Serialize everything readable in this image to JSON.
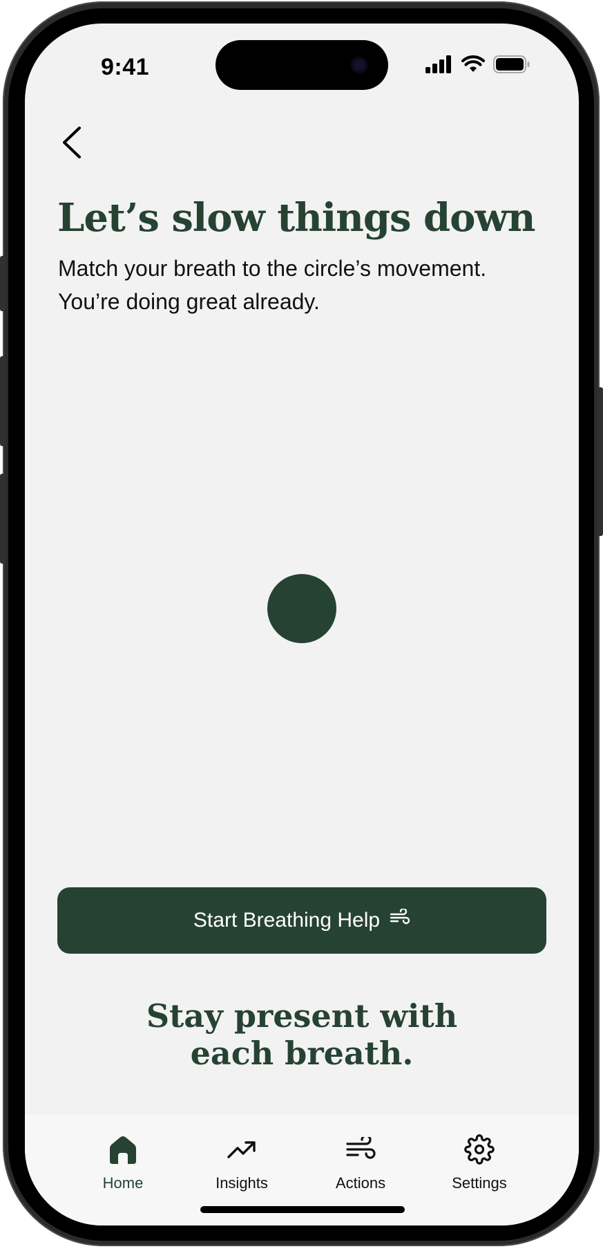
{
  "status_bar": {
    "time": "9:41",
    "icons": [
      "cellular-signal-icon",
      "wifi-icon",
      "battery-icon"
    ]
  },
  "header": {
    "back_icon": "chevron-left-icon"
  },
  "main": {
    "title": "Let’s slow things down",
    "subtitle_line1": "Match your breath to the circle’s movement.",
    "subtitle_line2": "You’re doing great already."
  },
  "cta": {
    "label": "Start Breathing Help",
    "icon": "wind-icon"
  },
  "tagline": {
    "line1": "Stay present with",
    "line2": "each breath."
  },
  "tabbar": {
    "tabs": [
      {
        "label": "Home",
        "icon": "home-icon",
        "active": true
      },
      {
        "label": "Insights",
        "icon": "trending-up-icon",
        "active": false
      },
      {
        "label": "Actions",
        "icon": "wind-icon",
        "active": false
      },
      {
        "label": "Settings",
        "icon": "gear-icon",
        "active": false
      }
    ]
  },
  "colors": {
    "accent": "#264233",
    "screen_background": "#f2f2f2",
    "tabbar_background": "#f7f7f7"
  }
}
